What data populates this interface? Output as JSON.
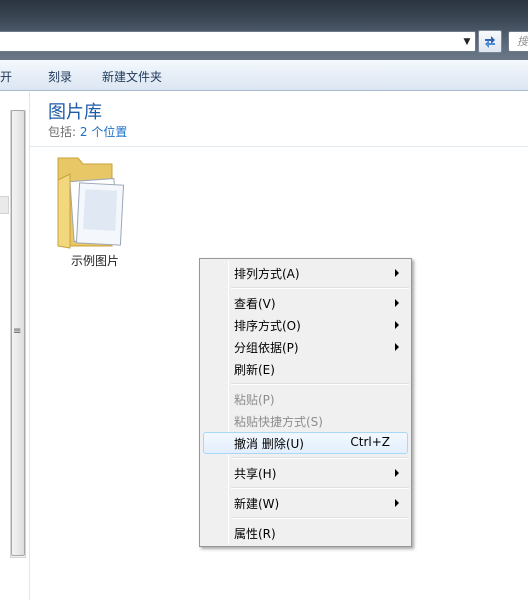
{
  "address": {
    "search_placeholder": "搜"
  },
  "toolbar": {
    "items": [
      "打开",
      "刻录",
      "新建文件夹"
    ]
  },
  "library": {
    "title": "图片库",
    "includes_label": "包括:",
    "includes_link": "2 个位置"
  },
  "folder": {
    "label": "示例图片"
  },
  "context_menu": {
    "items": [
      {
        "label": "排列方式(A)"
      },
      {
        "label": "查看(V)"
      },
      {
        "label": "排序方式(O)"
      },
      {
        "label": "分组依据(P)"
      },
      {
        "label": "刷新(E)"
      },
      {
        "label": "粘贴(P)"
      },
      {
        "label": "粘贴快捷方式(S)"
      },
      {
        "label": "撤消 删除(U)",
        "shortcut": "Ctrl+Z"
      },
      {
        "label": "共享(H)"
      },
      {
        "label": "新建(W)"
      },
      {
        "label": "属性(R)"
      }
    ]
  },
  "colors": {
    "link": "#1f6fc8",
    "library_title": "#1e5aa8",
    "menu_highlight_border": "#a8d8f7"
  }
}
